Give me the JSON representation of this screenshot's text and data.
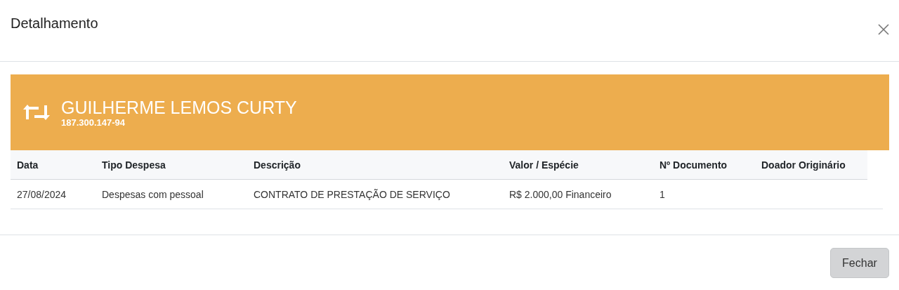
{
  "dialog": {
    "title": "Detalhamento"
  },
  "banner": {
    "name": "GUILHERME LEMOS CURTY",
    "document": "187.300.147-94"
  },
  "table": {
    "columns": [
      "Data",
      "Tipo Despesa",
      "Descrição",
      "Valor / Espécie",
      "Nº Documento",
      "Doador Originário"
    ],
    "rows": [
      [
        "27/08/2024",
        "Despesas com pessoal",
        "CONTRATO DE PRESTAÇÃO DE SERVIÇO",
        "R$ 2.000,00 Financeiro",
        "1",
        ""
      ]
    ]
  },
  "buttons": [
    "Fechar"
  ]
}
